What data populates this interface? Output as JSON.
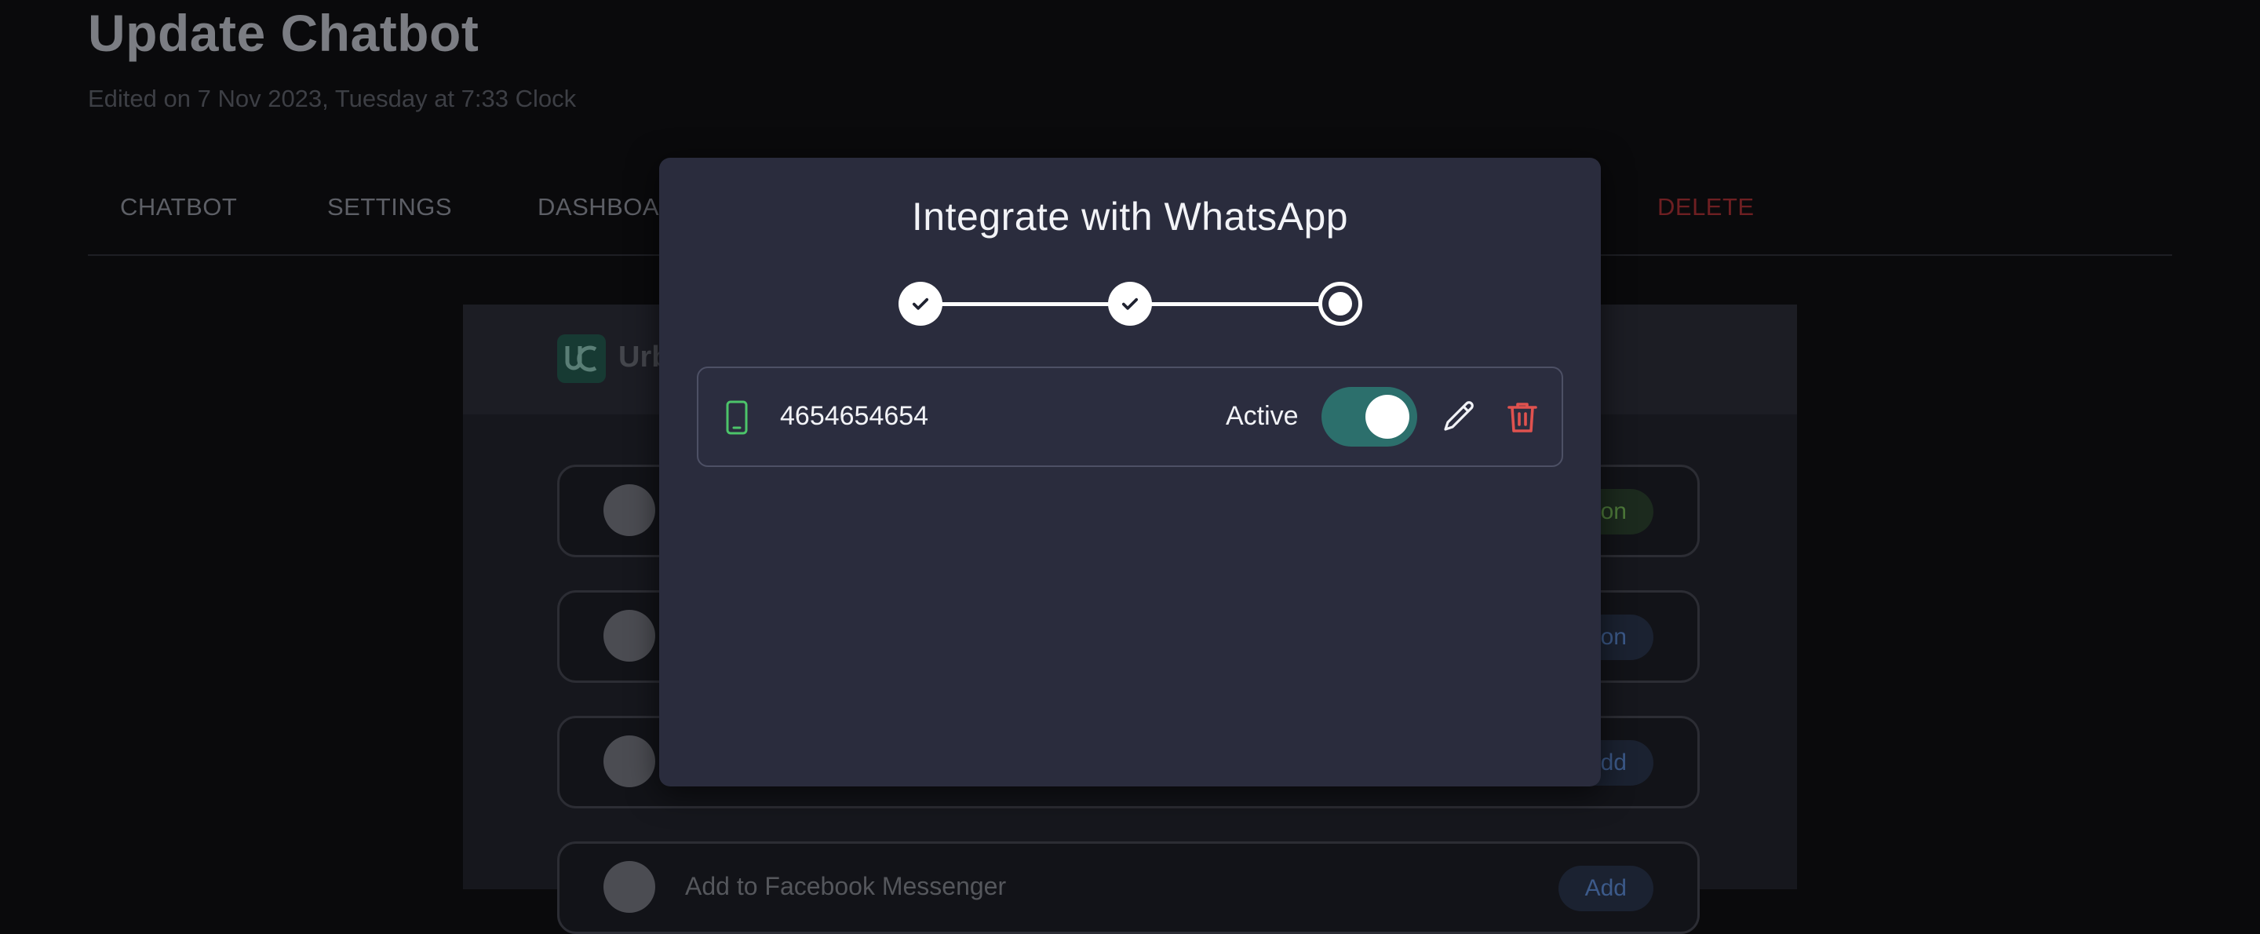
{
  "page": {
    "title": "Update Chatbot",
    "subtitle": "Edited on 7 Nov 2023, Tuesday at 7:33 Clock",
    "tabs": [
      {
        "label": "CHATBOT"
      },
      {
        "label": "SETTINGS"
      },
      {
        "label": "DASHBOA"
      },
      {
        "label": "DELETE"
      }
    ]
  },
  "panel": {
    "brand_text": "Urb",
    "integrations": [
      {
        "label": "",
        "button": "on"
      },
      {
        "label": "",
        "button": "on"
      },
      {
        "label": "",
        "button": "dd"
      },
      {
        "label": "Add to Facebook Messenger",
        "button": "Add"
      }
    ]
  },
  "modal": {
    "title": "Integrate with WhatsApp",
    "steps": [
      {
        "state": "complete",
        "icon": "check-icon"
      },
      {
        "state": "complete",
        "icon": "check-icon"
      },
      {
        "state": "current",
        "icon": "radio-icon"
      }
    ],
    "number": {
      "phone": "4654654654",
      "status": "Active",
      "enabled": true,
      "phone_icon": "smartphone-icon",
      "edit_icon": "pencil-icon",
      "delete_icon": "trash-icon"
    }
  },
  "colors": {
    "modal_bg": "#2a2c3d",
    "toggle_on": "#2c6f6c",
    "delete_red": "#e0524f",
    "phone_green": "#4cc46a"
  }
}
